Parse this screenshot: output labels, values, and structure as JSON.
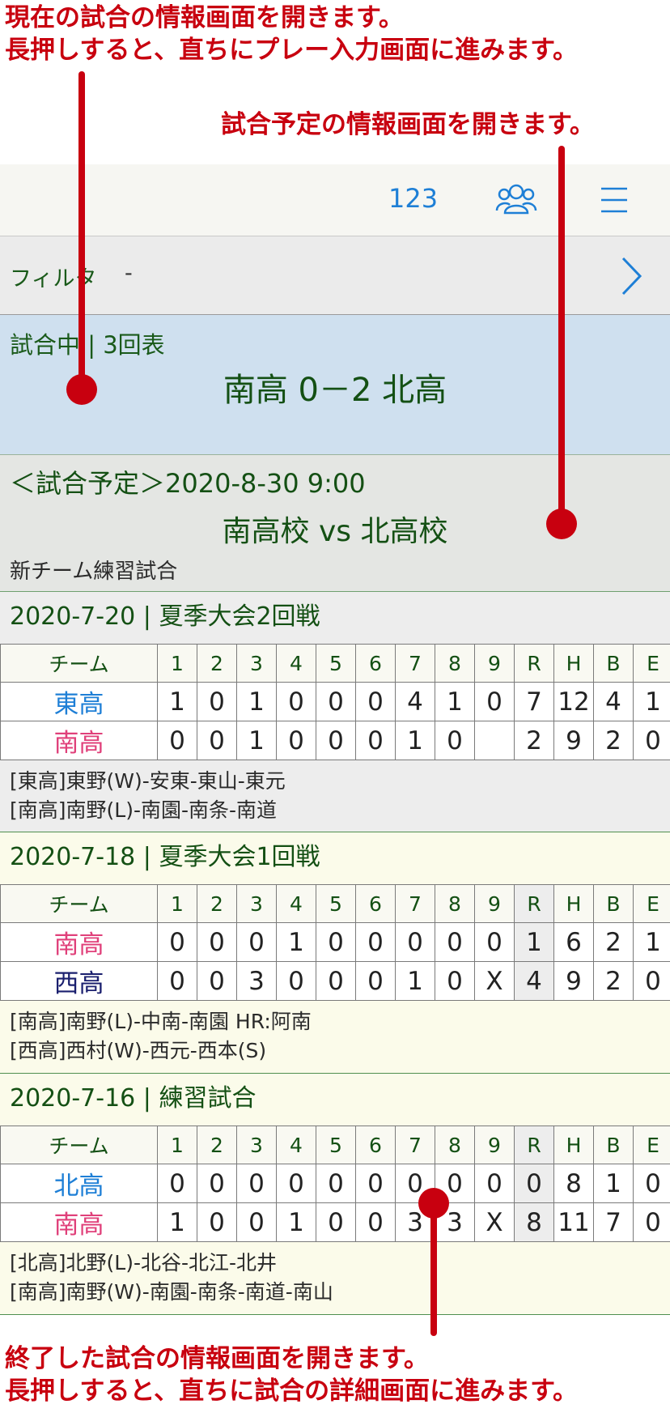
{
  "annotations": {
    "top_line1": "現在の試合の情報画面を開きます。",
    "top_line2": "長押しすると、直ちにプレー入力画面に進みます。",
    "scheduled": "試合予定の情報画面を開きます。",
    "bottom_line1": "終了した試合の情報画面を開きます。",
    "bottom_line2": "長押しすると、直ちに試合の詳細画面に進みます。"
  },
  "navbar": {
    "count": "123",
    "team_icon": "people-icon",
    "menu_icon": "menu-icon"
  },
  "filter": {
    "label": "フィルタ",
    "value": "-",
    "chevron": "chevron-right-icon"
  },
  "live_game": {
    "status": "試合中 | 3回表",
    "score": "南高 0－2 北高"
  },
  "scheduled_game": {
    "header": "＜試合予定＞2020-8-30  9:00",
    "matchup": "南高校 vs 北高校",
    "note": "新チーム練習試合"
  },
  "colors": {
    "annotation": "#c8000f",
    "link": "#1e7fd6",
    "live_bg": "#cfe0ef",
    "scheduled_bg": "#e4e6e3"
  },
  "box_headers": [
    "チーム",
    "1",
    "2",
    "3",
    "4",
    "5",
    "6",
    "7",
    "8",
    "9",
    "R",
    "H",
    "B",
    "E"
  ],
  "games": [
    {
      "title": "2020-7-20 | 夏季大会2回戦",
      "bg": "#ededed",
      "shade_r": false,
      "rows": [
        {
          "team": "東高",
          "color": "#1e7fd6",
          "cells": [
            "1",
            "0",
            "1",
            "0",
            "0",
            "0",
            "4",
            "1",
            "0",
            "7",
            "12",
            "4",
            "1"
          ]
        },
        {
          "team": "南高",
          "color": "#e0407a",
          "cells": [
            "0",
            "0",
            "1",
            "0",
            "0",
            "0",
            "1",
            "0",
            "",
            "2",
            "9",
            "2",
            "0"
          ]
        }
      ],
      "lineup": [
        "[東高]東野(W)-安東-東山-東元",
        "[南高]南野(L)-南園-南条-南道"
      ]
    },
    {
      "title": "2020-7-18 | 夏季大会1回戦",
      "bg": "#fbfbea",
      "shade_r": true,
      "rows": [
        {
          "team": "南高",
          "color": "#e0407a",
          "cells": [
            "0",
            "0",
            "0",
            "1",
            "0",
            "0",
            "0",
            "0",
            "0",
            "1",
            "6",
            "2",
            "1"
          ]
        },
        {
          "team": "西高",
          "color": "#1a1f6e",
          "cells": [
            "0",
            "0",
            "3",
            "0",
            "0",
            "0",
            "1",
            "0",
            "X",
            "4",
            "9",
            "2",
            "0"
          ]
        }
      ],
      "lineup": [
        "[南高]南野(L)-中南-南園 HR:阿南",
        "[西高]西村(W)-西元-西本(S)"
      ]
    },
    {
      "title": "2020-7-16 | 練習試合",
      "bg": "#fbfbea",
      "shade_r": true,
      "rows": [
        {
          "team": "北高",
          "color": "#1e7fd6",
          "cells": [
            "0",
            "0",
            "0",
            "0",
            "0",
            "0",
            "0",
            "0",
            "0",
            "0",
            "8",
            "1",
            "0"
          ]
        },
        {
          "team": "南高",
          "color": "#e0407a",
          "cells": [
            "1",
            "0",
            "0",
            "1",
            "0",
            "0",
            "3",
            "3",
            "X",
            "8",
            "11",
            "7",
            "0"
          ]
        }
      ],
      "lineup": [
        "[北高]北野(L)-北谷-北江-北井",
        "[南高]南野(W)-南園-南条-南道-南山"
      ]
    }
  ]
}
